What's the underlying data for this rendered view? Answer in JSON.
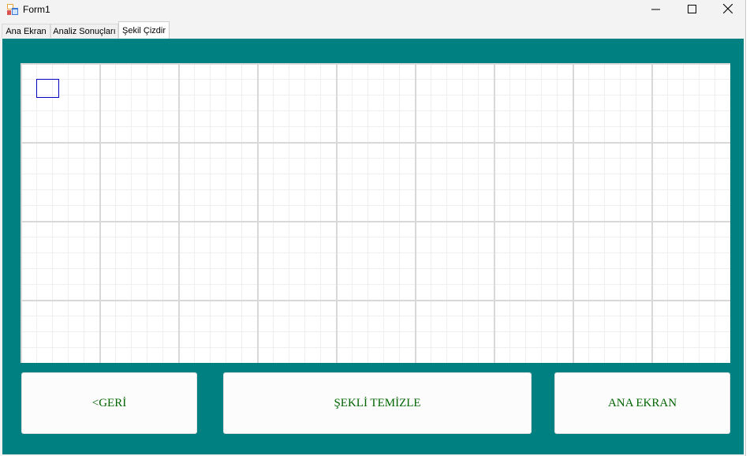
{
  "window": {
    "title": "Form1"
  },
  "tabs": [
    {
      "label": "Ana Ekran",
      "active": false
    },
    {
      "label": "Analiz Sonuçları",
      "active": false
    },
    {
      "label": "Şekil Çizdir",
      "active": true
    }
  ],
  "buttons": {
    "back": "<GERİ",
    "clear": "ŞEKLİ TEMİZLE",
    "home": "ANA EKRAN"
  },
  "colors": {
    "panel": "#008080",
    "button_text": "#006400",
    "shape_stroke": "#0000c8"
  },
  "icons": {
    "app": "form-app-icon",
    "minimize": "minimize-icon",
    "maximize": "maximize-icon",
    "close": "close-icon"
  }
}
